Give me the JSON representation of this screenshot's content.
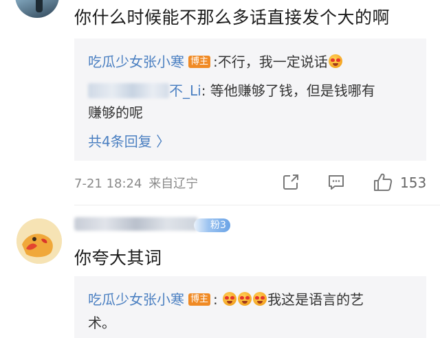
{
  "comment1": {
    "text": "你什么时候能不那么多话直接发个大的啊",
    "replies": {
      "reply1": {
        "author": "吃瓜少女张小寒",
        "badge": "博主",
        "text": ":不行，我一定说话"
      },
      "reply2": {
        "author_visible": "不_Li",
        "text_line1": ": 等他赚够了钱，但是钱哪有",
        "text_line2": "赚够的呢"
      },
      "more": "共4条回复 〉"
    },
    "meta": {
      "date": "7-21 18:24",
      "location": "来自辽宁",
      "like_count": "153"
    }
  },
  "comment2": {
    "fan_badge": "粉3",
    "text": "你夸大其词",
    "replies": {
      "reply1": {
        "author": "吃瓜少女张小寒",
        "badge": "博主",
        "text_prefix": ":",
        "text_line1": "我这是语言的艺",
        "text_line2": "术。"
      }
    }
  },
  "colors": {
    "link_blue": "#4a7fc1",
    "badge_orange": "#f08a24",
    "reply_bg": "#f5f5f7",
    "meta_gray": "#888888"
  },
  "icons": [
    "share-icon",
    "comment-icon",
    "like-icon",
    "emoji-icon"
  ]
}
